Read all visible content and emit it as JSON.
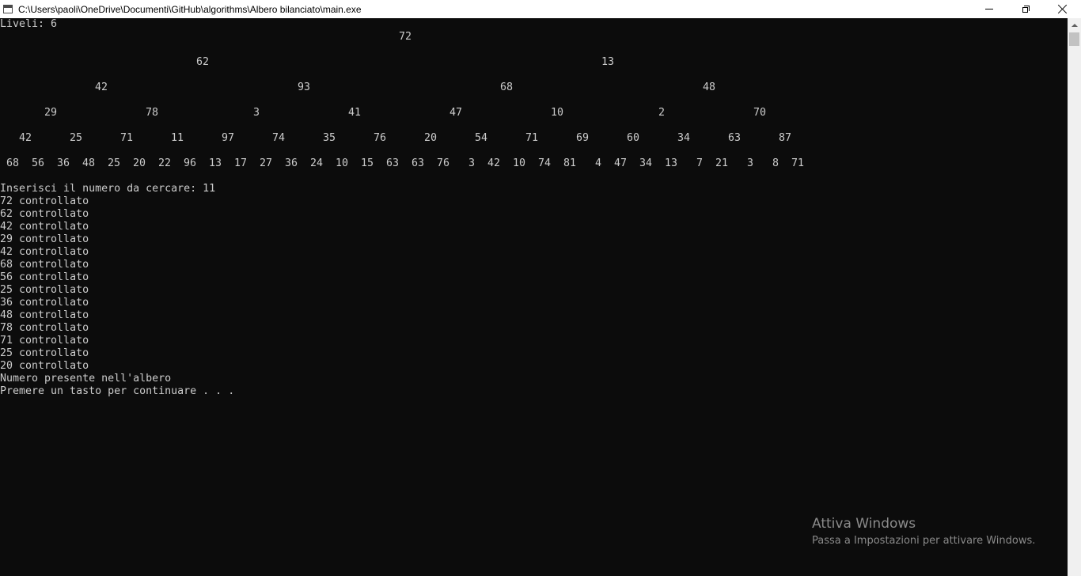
{
  "window": {
    "title": "C:\\Users\\paoli\\OneDrive\\Documenti\\GitHub\\algorithms\\Albero bilanciato\\main.exe",
    "icons": {
      "app": "console-app-icon",
      "minimize": "minimize-icon",
      "maximize": "restore-icon",
      "close": "close-icon"
    }
  },
  "console": {
    "levels_line": "Liveli: 6",
    "tree_levels": [
      [
        "72"
      ],
      [
        "62",
        "13"
      ],
      [
        "42",
        "93",
        "68",
        "48"
      ],
      [
        "29",
        "78",
        "3",
        "41",
        "47",
        "10",
        "2",
        "70"
      ],
      [
        "42",
        "25",
        "71",
        "11",
        "97",
        "74",
        "35",
        "76",
        "20",
        "54",
        "71",
        "69",
        "60",
        "34",
        "63",
        "87"
      ],
      [
        "68",
        "56",
        "36",
        "48",
        "25",
        "20",
        "22",
        "96",
        "13",
        "17",
        "27",
        "36",
        "24",
        "10",
        "15",
        "63",
        "63",
        "76",
        "3",
        "42",
        "10",
        "74",
        "81",
        "4",
        "47",
        "34",
        "13",
        "7",
        "21",
        "3",
        "8",
        "71"
      ]
    ],
    "prompt_line": "Inserisci il numero da cercare: 11",
    "checked": [
      "72",
      "62",
      "42",
      "29",
      "42",
      "68",
      "56",
      "25",
      "36",
      "48",
      "78",
      "71",
      "25",
      "20"
    ],
    "checked_suffix": " controllato",
    "result_line": "Numero presente nell'albero",
    "continue_line": "Premere un tasto per continuare . . ."
  },
  "watermark": {
    "title": "Attiva Windows",
    "subtitle": "Passa a Impostazioni per attivare Windows."
  },
  "colors": {
    "console_bg": "#0c0c0c",
    "console_text": "#cccccc",
    "titlebar_bg": "#ffffff",
    "watermark_text": "#8a8a8a"
  }
}
